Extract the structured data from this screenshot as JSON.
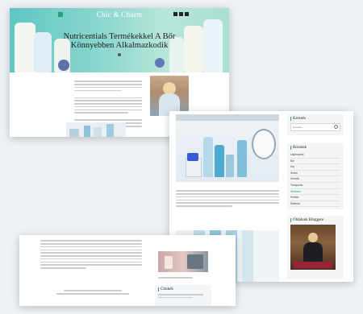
{
  "card1": {
    "site_title": "Chic & Charm",
    "hero_title": "Nutricentials Termékekkel A Bőr Könnyebben Alkalmazkodik"
  },
  "card2": {
    "search_title": "Keresés",
    "search_placeholder": "Keresés...",
    "categories_title": "Rovatok",
    "categories": [
      "Legfrissebb",
      "Bőr",
      "Haj",
      "Smink",
      "Körmök",
      "Testápolás",
      "Wellness",
      "Parfüm",
      "Életmód"
    ],
    "active_category_index": 6,
    "author_title": "Oldalunk Bloggere"
  },
  "card3": {
    "tags_title": "Címkék"
  },
  "colors": {
    "accent": "#2aa07a",
    "hero": "#7fd3ca"
  }
}
